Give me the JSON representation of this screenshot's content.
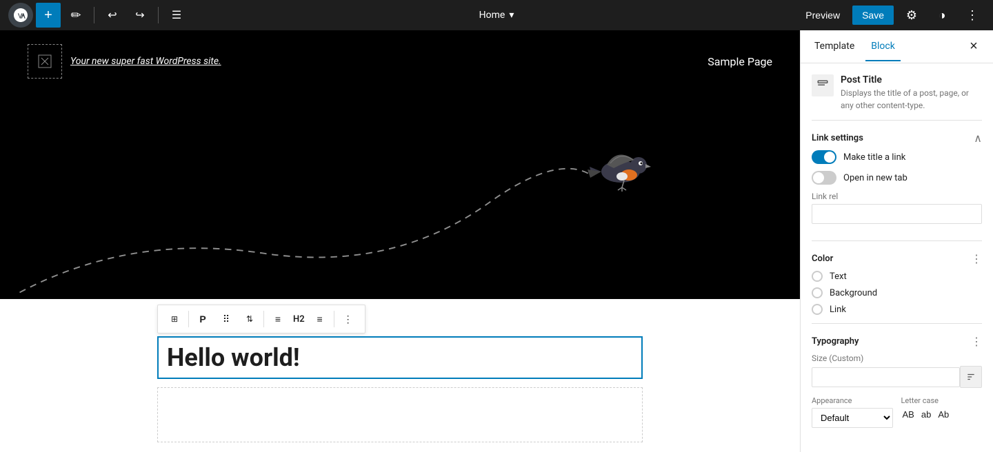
{
  "toolbar": {
    "add_label": "+",
    "page_title": "Home",
    "chevron": "▾",
    "preview_label": "Preview",
    "save_label": "Save"
  },
  "sidebar": {
    "template_tab": "Template",
    "block_tab": "Block",
    "close_icon": "×",
    "block_info": {
      "title": "Post Title",
      "description": "Displays the title of a post, page, or any other content-type."
    },
    "link_settings": {
      "title": "Link settings",
      "make_title_link_label": "Make title a link",
      "open_new_tab_label": "Open in new tab",
      "link_rel_label": "Link rel",
      "link_rel_placeholder": ""
    },
    "color": {
      "title": "Color",
      "options": [
        "Text",
        "Background",
        "Link"
      ]
    },
    "typography": {
      "title": "Typography",
      "size_label": "Size (Custom)",
      "appearance_label": "Appearance",
      "appearance_default": "Default",
      "letter_case_label": "Letter case",
      "letter_cases": [
        "AB",
        "ab",
        "Ab"
      ]
    }
  },
  "canvas": {
    "site_name": "Your new super fast WordPress site.",
    "nav_item": "Sample Page",
    "heading_text": "Hello world!",
    "heading_level": "H2"
  }
}
